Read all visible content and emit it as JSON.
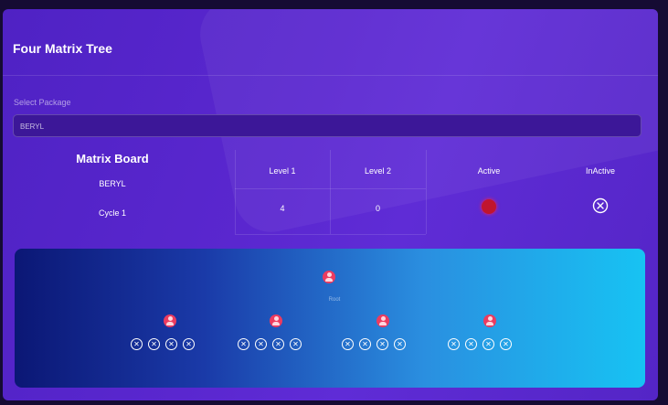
{
  "page": {
    "title": "Four Matrix Tree"
  },
  "package_select": {
    "label": "Select Package",
    "value": "BERYL"
  },
  "matrix": {
    "heading": "Matrix Board",
    "package": "BERYL",
    "cycle": "Cycle 1",
    "columns": [
      "Level 1",
      "Level 2",
      "Active",
      "InActive"
    ],
    "level1_value": "4",
    "level2_value": "0",
    "active_color": "#c0152e"
  },
  "tree": {
    "root_label": "Root",
    "root_icon": "user-icon",
    "child_count": 4,
    "slots_per_child": 4,
    "empty_slot_icon": "close-circle-icon"
  },
  "colors": {
    "card_bg": "#5425c6",
    "tree_start": "#0b1775",
    "tree_end": "#17c3f3",
    "user_icon": "#ec3b5f"
  }
}
